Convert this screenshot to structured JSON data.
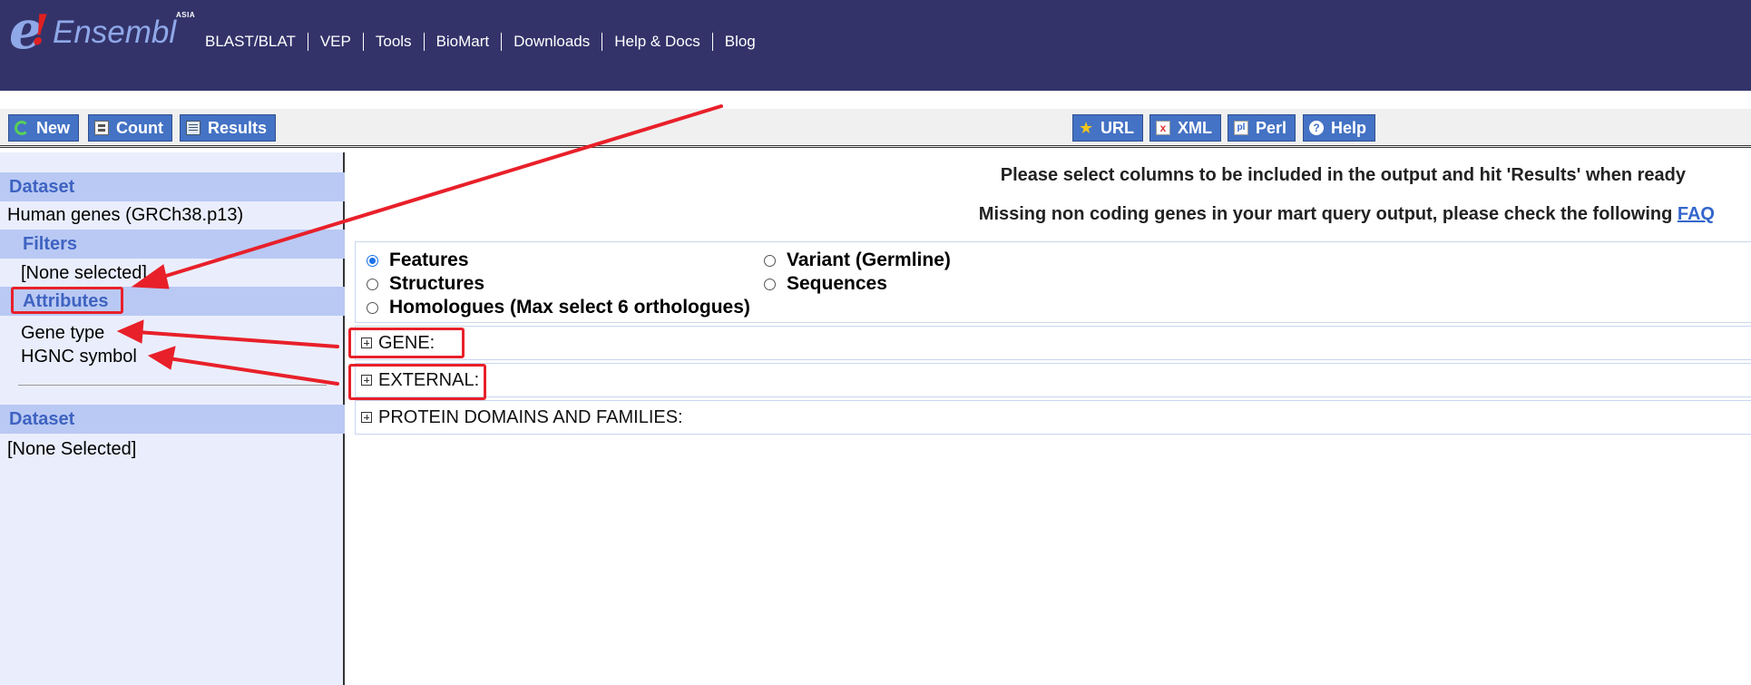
{
  "logo": {
    "letter": "e",
    "bang": "!",
    "word": "Ensembl",
    "sup": "ASIA"
  },
  "topnav": [
    "BLAST/BLAT",
    "VEP",
    "Tools",
    "BioMart",
    "Downloads",
    "Help & Docs",
    "Blog"
  ],
  "toolbar": {
    "new_label": "New",
    "count_label": "Count",
    "results_label": "Results",
    "url_label": "URL",
    "xml_label": "XML",
    "perl_label": "Perl",
    "help_label": "Help"
  },
  "sidebar": {
    "dataset_heading": "Dataset",
    "dataset_value": "Human genes (GRCh38.p13)",
    "filters_heading": "Filters",
    "filters_value": "[None selected]",
    "attributes_heading": "Attributes",
    "attributes": [
      "Gene type",
      "HGNC symbol"
    ],
    "dataset2_heading": "Dataset",
    "dataset2_value": "[None Selected]"
  },
  "main": {
    "message1": "Please select columns to be included in the output and hit 'Results' when ready",
    "message2": "Missing non coding genes in your mart query output, please check the following",
    "faq_link": "FAQ",
    "radio_options": [
      {
        "label": "Features",
        "selected": true
      },
      {
        "label": "Variant (Germline)",
        "selected": false
      },
      {
        "label": "Structures",
        "selected": false
      },
      {
        "label": "Sequences",
        "selected": false
      },
      {
        "label": "Homologues (Max select 6 orthologues)",
        "selected": false
      }
    ],
    "sections": [
      "GENE:",
      "EXTERNAL:",
      "PROTEIN DOMAINS AND FAMILIES:"
    ]
  },
  "colors": {
    "header_bg": "#33336a",
    "sidebar_bg": "#eaeefc",
    "sidebar_heading_bg": "#b9c9f4",
    "button_bg": "#4472c4",
    "annotation_red": "#e8202a"
  }
}
